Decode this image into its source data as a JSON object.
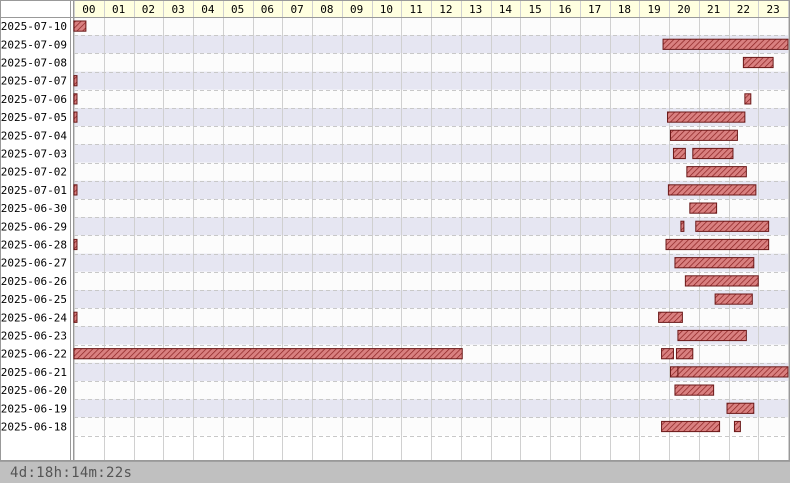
{
  "chart_data": {
    "type": "gantt",
    "x_ticks": [
      "00",
      "01",
      "02",
      "03",
      "04",
      "05",
      "06",
      "07",
      "08",
      "09",
      "10",
      "11",
      "12",
      "13",
      "14",
      "15",
      "16",
      "17",
      "18",
      "19",
      "20",
      "21",
      "22",
      "23"
    ],
    "x_range_hours": [
      0,
      24
    ],
    "rows": [
      {
        "date": "2025-07-10",
        "bars": [
          [
            0.0,
            0.4
          ]
        ]
      },
      {
        "date": "2025-07-09",
        "bars": [
          [
            19.8,
            24.0
          ]
        ]
      },
      {
        "date": "2025-07-08",
        "bars": [
          [
            22.5,
            23.5
          ]
        ]
      },
      {
        "date": "2025-07-07",
        "bars": [
          [
            0.0,
            0.06
          ]
        ]
      },
      {
        "date": "2025-07-06",
        "bars": [
          [
            0.0,
            0.06
          ],
          [
            22.55,
            22.75
          ]
        ]
      },
      {
        "date": "2025-07-05",
        "bars": [
          [
            0.0,
            0.06
          ],
          [
            19.95,
            22.55
          ]
        ]
      },
      {
        "date": "2025-07-04",
        "bars": [
          [
            20.05,
            22.3
          ]
        ]
      },
      {
        "date": "2025-07-03",
        "bars": [
          [
            20.15,
            20.55
          ],
          [
            20.8,
            22.15
          ]
        ]
      },
      {
        "date": "2025-07-02",
        "bars": [
          [
            20.6,
            22.6
          ]
        ]
      },
      {
        "date": "2025-07-01",
        "bars": [
          [
            0.0,
            0.06
          ],
          [
            19.98,
            22.92
          ]
        ]
      },
      {
        "date": "2025-06-30",
        "bars": [
          [
            20.7,
            21.6
          ]
        ]
      },
      {
        "date": "2025-06-29",
        "bars": [
          [
            20.4,
            20.45
          ],
          [
            20.9,
            23.35
          ]
        ]
      },
      {
        "date": "2025-06-28",
        "bars": [
          [
            0.0,
            0.06
          ],
          [
            19.9,
            23.35
          ]
        ]
      },
      {
        "date": "2025-06-27",
        "bars": [
          [
            20.2,
            22.85
          ]
        ]
      },
      {
        "date": "2025-06-26",
        "bars": [
          [
            20.55,
            23.0
          ]
        ]
      },
      {
        "date": "2025-06-25",
        "bars": [
          [
            21.55,
            22.8
          ]
        ]
      },
      {
        "date": "2025-06-24",
        "bars": [
          [
            0.0,
            0.06
          ],
          [
            19.65,
            20.45
          ]
        ]
      },
      {
        "date": "2025-06-23",
        "bars": [
          [
            20.3,
            22.6
          ]
        ]
      },
      {
        "date": "2025-06-22",
        "bars": [
          [
            0.0,
            13.05
          ],
          [
            19.75,
            20.15
          ],
          [
            20.25,
            20.8
          ]
        ]
      },
      {
        "date": "2025-06-21",
        "bars": [
          [
            20.05,
            20.3
          ],
          [
            20.3,
            24.0
          ]
        ]
      },
      {
        "date": "2025-06-20",
        "bars": [
          [
            20.2,
            21.5
          ]
        ]
      },
      {
        "date": "2025-06-19",
        "bars": [
          [
            21.95,
            22.85
          ]
        ]
      },
      {
        "date": "2025-06-18",
        "bars": [
          [
            19.75,
            21.7
          ],
          [
            22.2,
            22.4
          ]
        ]
      }
    ],
    "bar_color": "#d98080",
    "bar_hatch_color": "#8a2020",
    "row_band_colors": [
      "#fcfcfc",
      "#e6e6f2"
    ],
    "header_color": "#ffffe0"
  },
  "footer": {
    "duration": "4d:18h:14m:22s"
  }
}
